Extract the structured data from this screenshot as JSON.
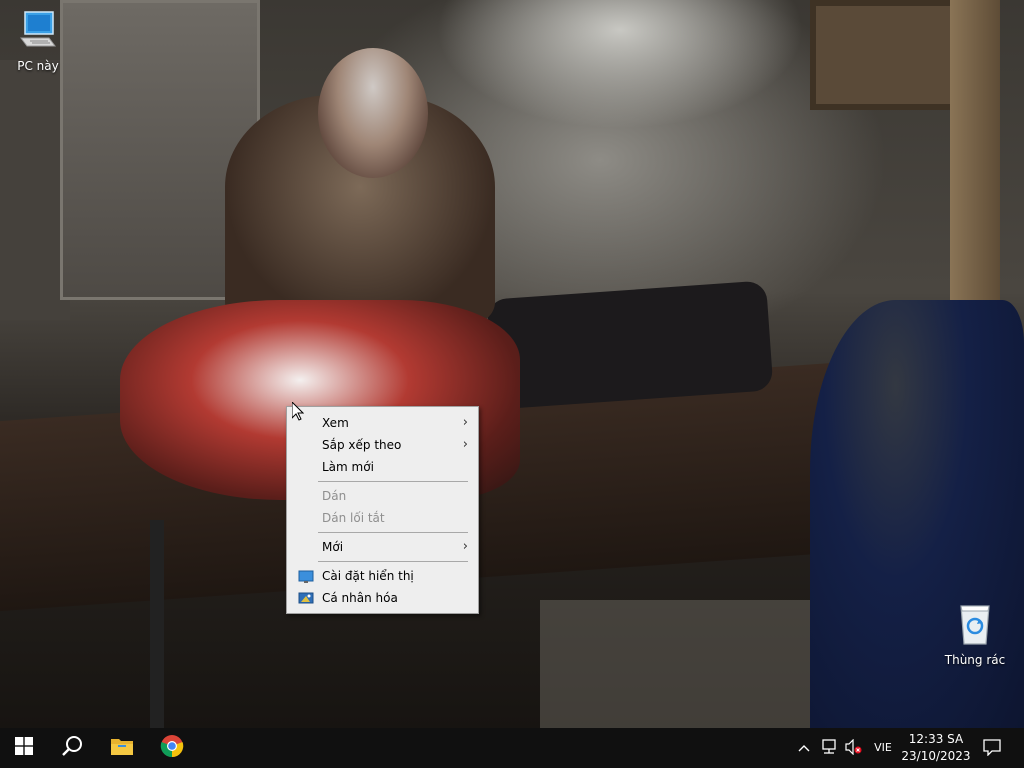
{
  "desktop": {
    "icons": [
      {
        "label": "PC này",
        "icon": "this-pc-icon"
      },
      {
        "label": "Thùng rác",
        "icon": "recycle-bin-icon"
      }
    ]
  },
  "context_menu": {
    "items": [
      {
        "label": "Xem",
        "submenu": true,
        "enabled": true
      },
      {
        "label": "Sắp xếp theo",
        "submenu": true,
        "enabled": true
      },
      {
        "label": "Làm mới",
        "submenu": false,
        "enabled": true
      },
      {
        "label": "Dán",
        "submenu": false,
        "enabled": false
      },
      {
        "label": "Dán lối tắt",
        "submenu": false,
        "enabled": false
      },
      {
        "label": "Mới",
        "submenu": true,
        "enabled": true
      },
      {
        "label": "Cài đặt hiển thị",
        "icon": "display-settings-icon",
        "enabled": true
      },
      {
        "label": "Cá nhân hóa",
        "icon": "personalize-icon",
        "enabled": true
      }
    ],
    "chevron": "›"
  },
  "taskbar": {
    "start_icon": "windows-start-icon",
    "search_icon": "search-icon",
    "pinned": [
      "file-explorer-icon",
      "chrome-icon"
    ],
    "tray": {
      "chevron": "^",
      "language": "VIE",
      "time": "12:33 SA",
      "date": "23/10/2023"
    }
  },
  "colors": {
    "taskbar": "#101010",
    "menu_bg": "#eeeeee",
    "accent": "#0078d7"
  }
}
